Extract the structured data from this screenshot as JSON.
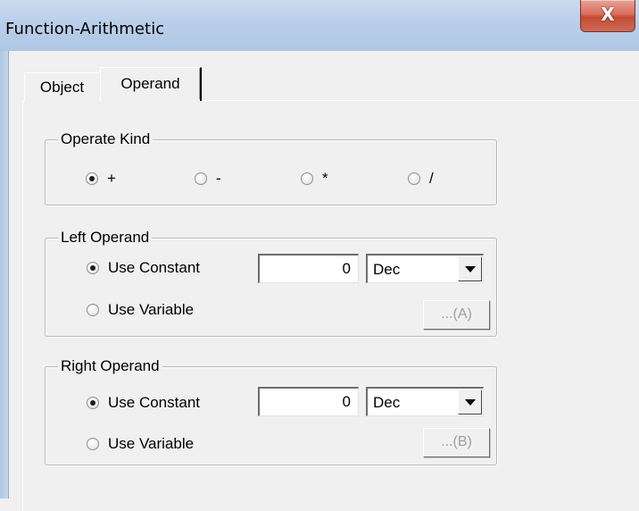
{
  "window": {
    "title": "Function-Arithmetic",
    "close_symbol": "X"
  },
  "tabs": [
    {
      "label": "Object",
      "selected": false
    },
    {
      "label": "Operand",
      "selected": true
    }
  ],
  "operate_kind": {
    "label": "Operate Kind",
    "options": [
      {
        "label": "+",
        "checked": true
      },
      {
        "label": "-",
        "checked": false
      },
      {
        "label": "*",
        "checked": false
      },
      {
        "label": "/",
        "checked": false
      }
    ]
  },
  "left_operand": {
    "label": "Left Operand",
    "use_constant_label": "Use Constant",
    "use_variable_label": "Use Variable",
    "selected": "constant",
    "constant_value": "0",
    "format_value": "Dec",
    "browse_label": "...(A)"
  },
  "right_operand": {
    "label": "Right Operand",
    "use_constant_label": "Use Constant",
    "use_variable_label": "Use Variable",
    "selected": "constant",
    "constant_value": "0",
    "format_value": "Dec",
    "browse_label": "...(B)"
  }
}
